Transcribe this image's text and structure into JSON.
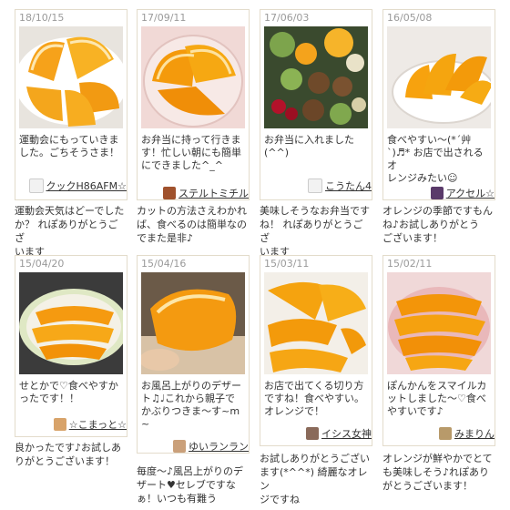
{
  "cards": [
    {
      "date": "18/10/15",
      "caption": "運動会にもっていきま\nした。ごちそうさま！",
      "user": "クックH86AFM☆",
      "avatar": "chef-hat-icon",
      "reply": "運動会天気はどーでした\nか？ れぽありがとうござ\nいます"
    },
    {
      "date": "17/09/11",
      "caption": "お弁当に持って行きま\nす！忙しい朝にも簡単\nにできました^_^",
      "user": "ステルトミチル",
      "avatar": "user-photo-icon",
      "reply": "カットの方法さえわかれ\nば、食べるのは簡単なの\nでまた是非♪"
    },
    {
      "date": "17/06/03",
      "caption": "お弁当に入れました\n(^^)",
      "user": "こうたん4",
      "avatar": "chef-hat-icon",
      "reply": "美味しそうなお弁当です\nね！ れぽありがとうござ\nいます"
    },
    {
      "date": "16/05/08",
      "caption": "食べやすい〜(*´艸\n`)♬* お店で出されるオ\nレンジみたい☺",
      "user": "アクセル☆",
      "avatar": "user-photo-icon",
      "reply": "オレンジの季節ですもん\nね♪お試しありがとう\nございます！"
    },
    {
      "date": "15/04/20",
      "caption": "せとかで♡食べやすか\nったです！！",
      "user": "☆こまっと☆",
      "avatar": "user-photo-icon",
      "reply": "良かったです♪お試しあ\nりがとうございます！"
    },
    {
      "date": "15/04/16",
      "caption": "お風呂上がりのデザー\nト♫♩これから親子で\nかぶりつきま〜す~m\n~",
      "user": "ゆいランラン",
      "avatar": "user-photo-icon",
      "reply": "毎度〜♪風呂上がりのデ\nザート♥セレブですな\nぁ！いつも有難う"
    },
    {
      "date": "15/03/11",
      "caption": "お店で出てくる切り方\nですね！食べやすい。\nオレンジで！",
      "user": "イシス女神",
      "avatar": "user-photo-icon",
      "reply": "お試しありがとうござい\nます(*^^*) 綺麗なオレン\nジですね"
    },
    {
      "date": "15/02/11",
      "caption": "ぽんかんをスマイルカ\nットしました〜♡食べ\nやすいです♪",
      "user": "みまりん",
      "avatar": "user-photo-icon",
      "reply": "オレンジが鮮やかでとて\nも美味しそう♪れぽあり\nがとうございます！"
    }
  ]
}
